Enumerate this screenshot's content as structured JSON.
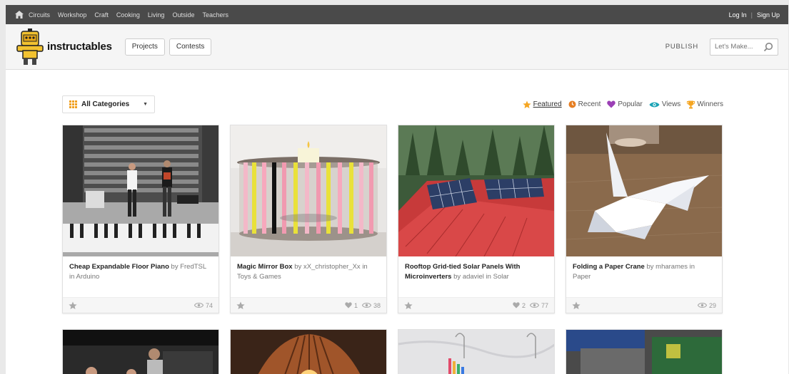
{
  "topnav": {
    "links": [
      "Circuits",
      "Workshop",
      "Craft",
      "Cooking",
      "Living",
      "Outside",
      "Teachers"
    ],
    "login": "Log In",
    "separator": "|",
    "signup": "Sign Up"
  },
  "header": {
    "brand": "instructables",
    "projects": "Projects",
    "contests": "Contests",
    "publish": "PUBLISH",
    "search_placeholder": "Let's Make..."
  },
  "filter": {
    "category": "All Categories",
    "sorts": [
      {
        "label": "Featured",
        "icon": "star-icon",
        "color": "#f5a623"
      },
      {
        "label": "Recent",
        "icon": "clock-icon",
        "color": "#e67e22"
      },
      {
        "label": "Popular",
        "icon": "heart-icon",
        "color": "#9b3fb5"
      },
      {
        "label": "Views",
        "icon": "eye-icon",
        "color": "#1aa3b5"
      },
      {
        "label": "Winners",
        "icon": "trophy-icon",
        "color": "#f5a623"
      }
    ]
  },
  "projects": [
    {
      "title": "Cheap Expandable Floor Piano",
      "by": "by",
      "author": "FredTSL",
      "in": "in",
      "category": "Arduino",
      "likes": "",
      "views": "74"
    },
    {
      "title": "Magic Mirror Box",
      "by": "by",
      "author": "xX_christopher_Xx",
      "in": "in",
      "category": "Toys & Games",
      "likes": "1",
      "views": "38"
    },
    {
      "title": "Rooftop Grid-tied Solar Panels With Microinverters",
      "by": "by",
      "author": "adaviel",
      "in": "in",
      "category": "Solar",
      "likes": "2",
      "views": "77"
    },
    {
      "title": "Folding a Paper Crane",
      "by": "by",
      "author": "mharames",
      "in": "in",
      "category": "Paper",
      "likes": "",
      "views": "29"
    }
  ]
}
